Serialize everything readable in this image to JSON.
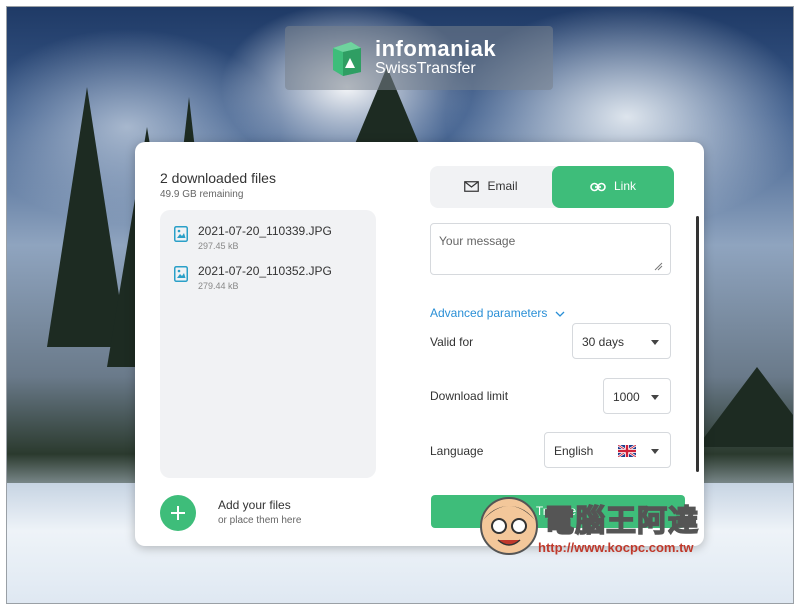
{
  "brand": {
    "name": "infomaniak",
    "product": "SwissTransfer"
  },
  "files_panel": {
    "title": "2 downloaded files",
    "remaining": "49.9 GB remaining",
    "files": [
      {
        "name": "2021-07-20_110339.JPG",
        "size": "297.45 kB",
        "icon": "image-file-icon"
      },
      {
        "name": "2021-07-20_110352.JPG",
        "size": "279.44 kB",
        "icon": "image-file-icon"
      }
    ],
    "add_title": "Add your files",
    "add_subtitle": "or place them here",
    "add_icon": "plus-icon"
  },
  "tabs": {
    "email_label": "Email",
    "email_icon": "envelope-icon",
    "link_label": "Link",
    "link_icon": "link-icon",
    "active": "Link"
  },
  "message": {
    "placeholder": "Your message",
    "value": ""
  },
  "advanced": {
    "label": "Advanced parameters"
  },
  "settings": {
    "valid_for": {
      "label": "Valid for",
      "value": "30 days"
    },
    "download_limit": {
      "label": "Download limit",
      "value": "1000"
    },
    "language": {
      "label": "Language",
      "value": "English",
      "flag": "uk-flag-icon"
    }
  },
  "transfer_label": "Transfer",
  "watermark": {
    "title": "電腦王阿達",
    "url": "http://www.kocpc.com.tw"
  },
  "colors": {
    "accent": "#3ebd7a",
    "link": "#2a8fd6",
    "panel_bg": "#f1f2f4"
  }
}
